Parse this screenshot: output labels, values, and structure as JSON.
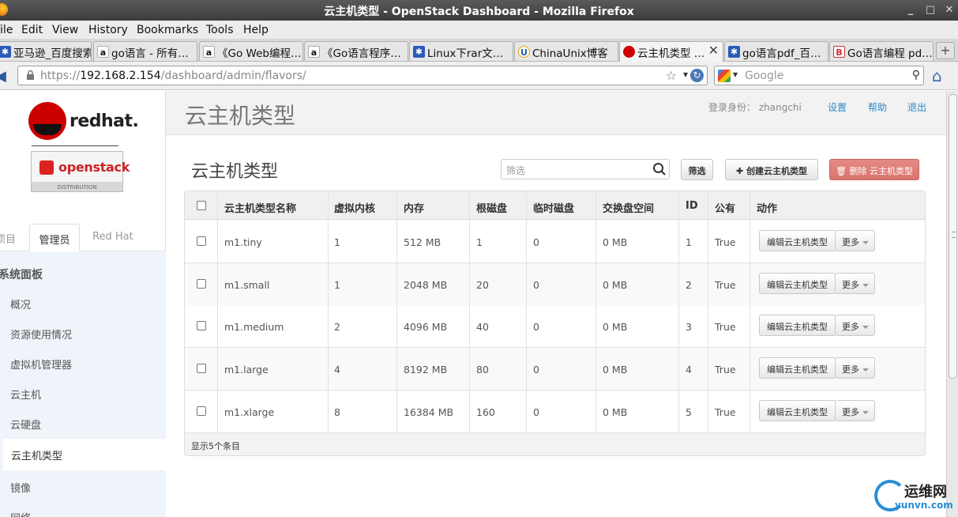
{
  "window": {
    "title": "云主机类型 - OpenStack Dashboard - Mozilla Firefox",
    "min": "_",
    "max": "□",
    "close": "✕"
  },
  "menu": [
    "File",
    "Edit",
    "View",
    "History",
    "Bookmarks",
    "Tools",
    "Help"
  ],
  "tabs": [
    {
      "label": "亚马逊_百度搜索",
      "icon": "paw-icon"
    },
    {
      "label": "go语言 - 所有…",
      "icon": "a-icon"
    },
    {
      "label": "《Go Web编程…",
      "icon": "a-icon"
    },
    {
      "label": "《Go语言程序…",
      "icon": "a-icon"
    },
    {
      "label": "Linux下rar文…",
      "icon": "paw-icon"
    },
    {
      "label": "ChinaUnix博客",
      "icon": "cu-icon"
    },
    {
      "label": "云主机类型 …",
      "icon": "redhat-icon",
      "close": "✕"
    },
    {
      "label": "go语言pdf_百…",
      "icon": "paw-icon"
    },
    {
      "label": "Go语言编程 pd…",
      "icon": "b-icon"
    }
  ],
  "newtab": "+",
  "nav": {
    "url_prefix": "https://",
    "url_host": "192.168.2.154",
    "url_path": "/dashboard/admin/flavors/",
    "search_placeholder": "Google"
  },
  "sidebar": {
    "brand": "redhat.",
    "openstack": "openstack",
    "distribution": "DISTRIBUTION",
    "tabs": [
      "项目",
      "管理员",
      "Red Hat"
    ],
    "section": "系统面板",
    "items": [
      "概况",
      "资源使用情况",
      "虚拟机管理器",
      "云主机",
      "云硬盘",
      "云主机类型",
      "镜像",
      "网络"
    ]
  },
  "header": {
    "title": "云主机类型",
    "user_label": "登录身份：",
    "user": "zhangchi",
    "settings": "设置",
    "help": "帮助",
    "logout": "退出"
  },
  "table": {
    "title": "云主机类型",
    "filter_placeholder": "筛选",
    "filter_button": "筛选",
    "create_button": "创建云主机类型",
    "delete_button": "删除 云主机类型",
    "columns": [
      "云主机类型名称",
      "虚拟内核",
      "内存",
      "根磁盘",
      "临时磁盘",
      "交换盘空间",
      "ID",
      "公有",
      "动作"
    ],
    "rows": [
      {
        "name": "m1.tiny",
        "vcpus": "1",
        "ram": "512 MB",
        "root": "1",
        "ephemeral": "0",
        "swap": "0 MB",
        "id": "1",
        "public": "True"
      },
      {
        "name": "m1.small",
        "vcpus": "1",
        "ram": "2048 MB",
        "root": "20",
        "ephemeral": "0",
        "swap": "0 MB",
        "id": "2",
        "public": "True"
      },
      {
        "name": "m1.medium",
        "vcpus": "2",
        "ram": "4096 MB",
        "root": "40",
        "ephemeral": "0",
        "swap": "0 MB",
        "id": "3",
        "public": "True"
      },
      {
        "name": "m1.large",
        "vcpus": "4",
        "ram": "8192 MB",
        "root": "80",
        "ephemeral": "0",
        "swap": "0 MB",
        "id": "4",
        "public": "True"
      },
      {
        "name": "m1.xlarge",
        "vcpus": "8",
        "ram": "16384 MB",
        "root": "160",
        "ephemeral": "0",
        "swap": "0 MB",
        "id": "5",
        "public": "True"
      }
    ],
    "edit_label": "编辑云主机类型",
    "more_label": "更多",
    "footer": "显示5个条目"
  },
  "watermark": {
    "text": "运维网",
    "url": "yunvn.com"
  }
}
